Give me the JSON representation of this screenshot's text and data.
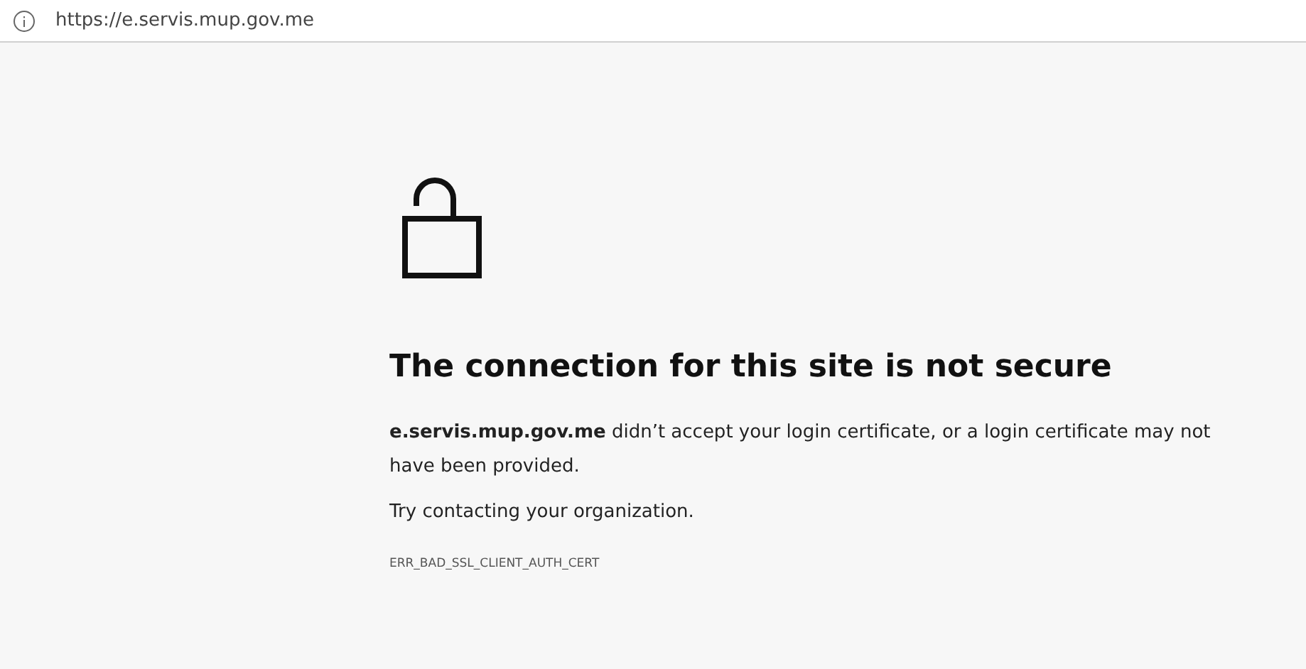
{
  "address_bar": {
    "url": "https://e.servis.mup.gov.me"
  },
  "error": {
    "title": "The connection for this site is not secure",
    "message": "**e.servis.mup.gov.me** didn’t accept your login certificate, or a login certificate may not have been provided.",
    "suggestion": "Try contacting your organization.",
    "code": "ERR_BAD_SSL_CLIENT_AUTH_CERT"
  }
}
